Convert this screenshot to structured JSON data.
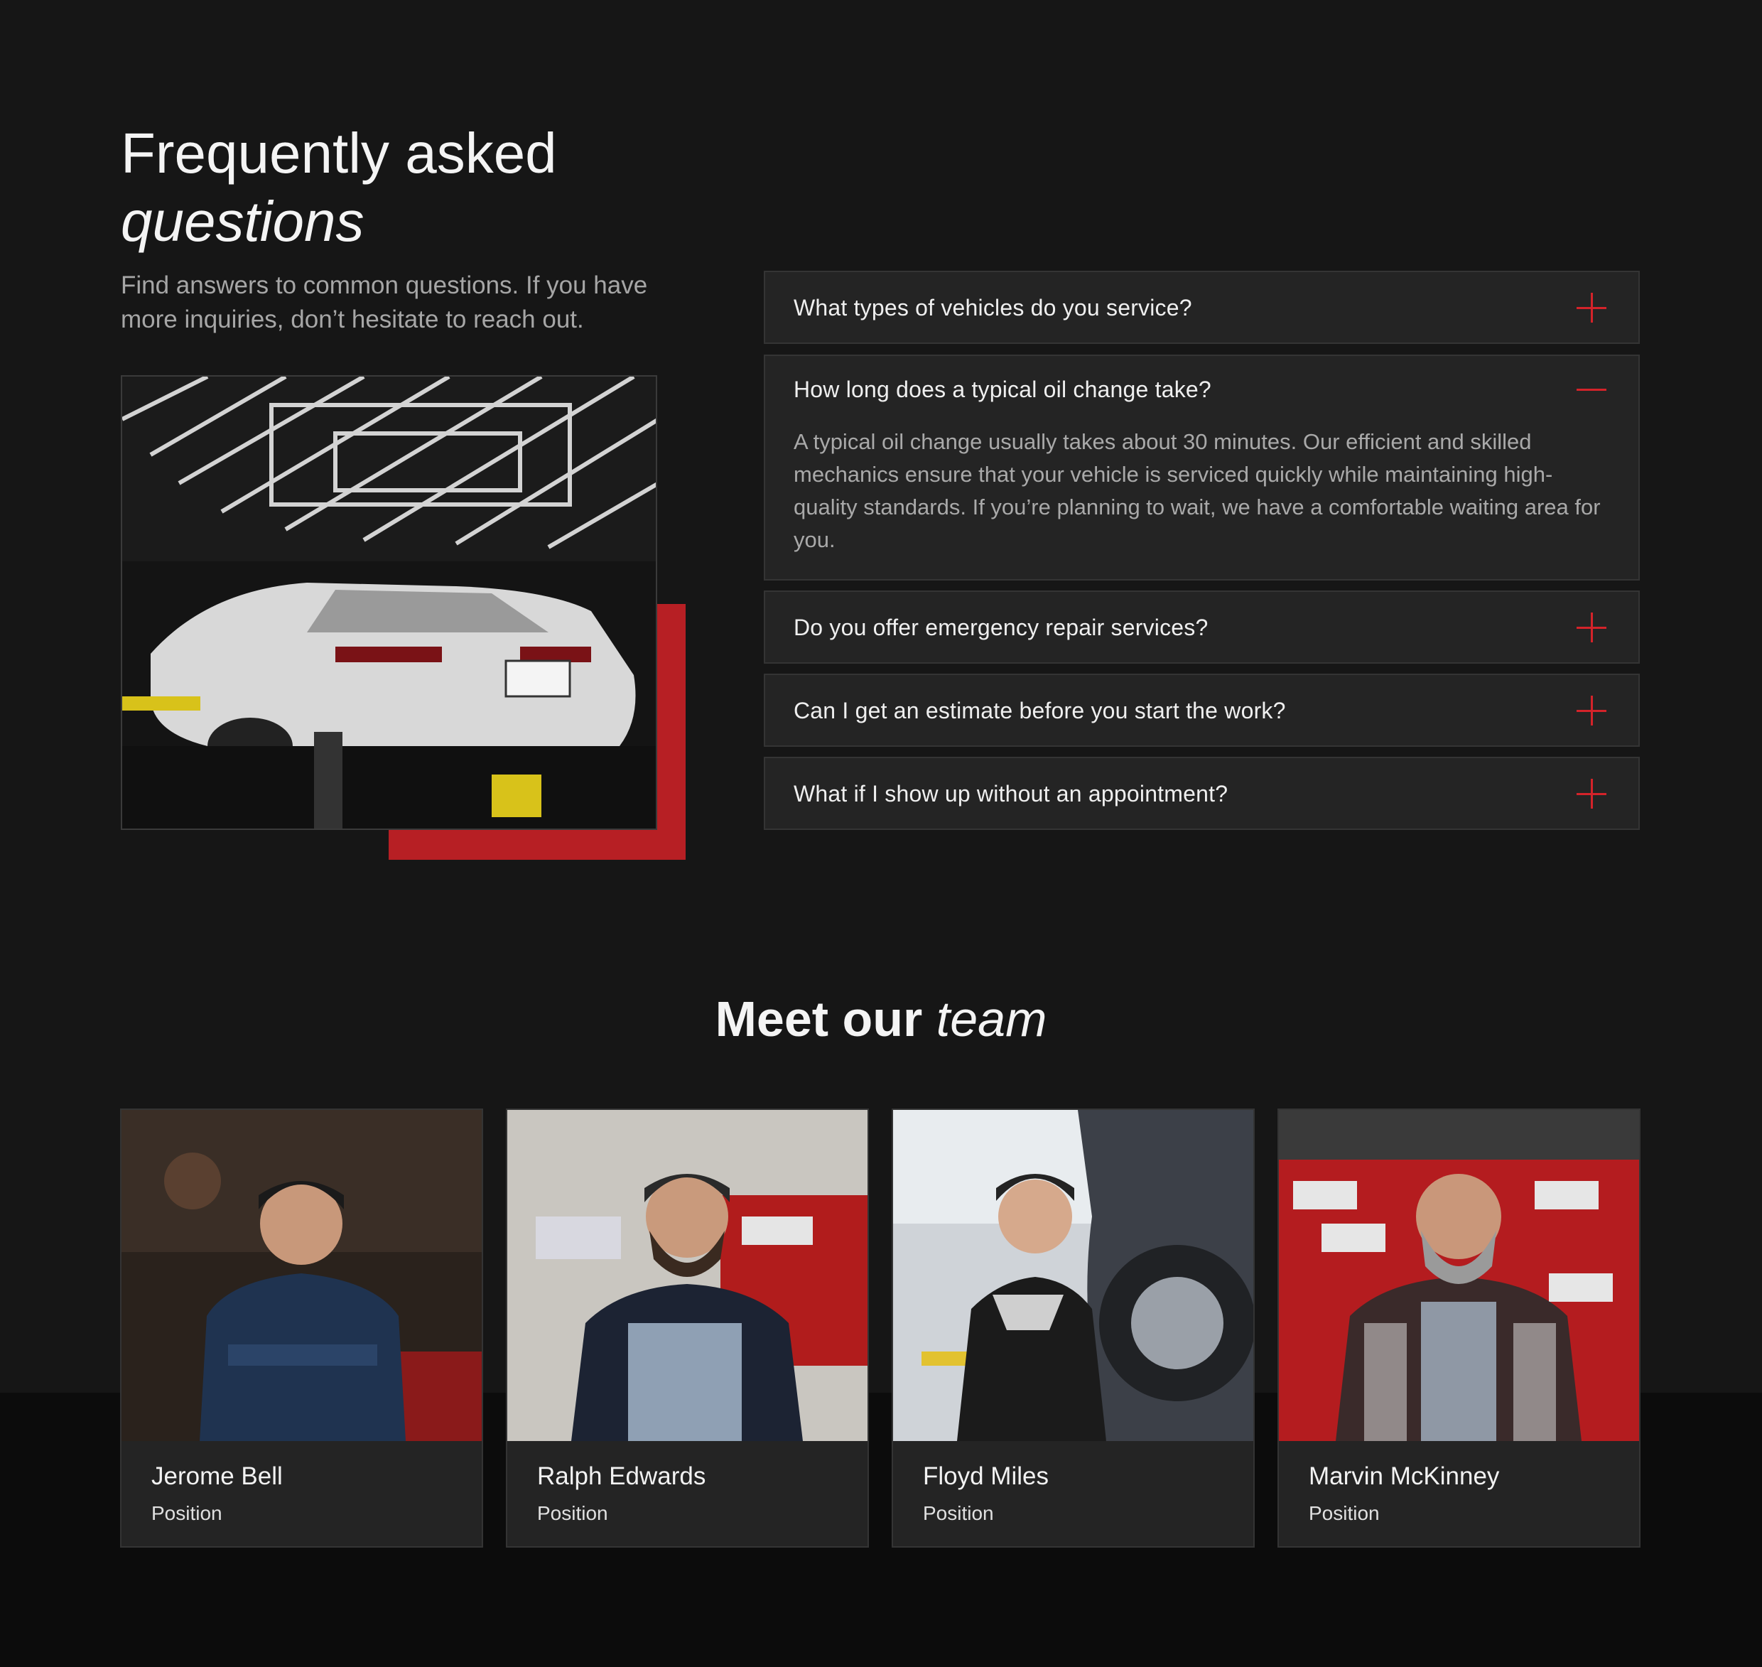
{
  "faq": {
    "title_line1": "Frequently asked",
    "title_line2": "questions",
    "subtitle": "Find answers to common questions. If you have more inquiries, don’t hesitate to reach out.",
    "items": [
      {
        "question": "What types of vehicles do you service?",
        "expanded": false
      },
      {
        "question": "How long does a typical oil change take?",
        "expanded": true,
        "answer": "A typical oil change usually takes about 30 minutes. Our efficient and skilled mechanics ensure that your vehicle is serviced quickly while maintaining high-quality standards. If you’re planning to wait, we have a comfortable waiting area for you."
      },
      {
        "question": "Do you offer emergency repair services?",
        "expanded": false
      },
      {
        "question": "Can I get an estimate before you start the work?",
        "expanded": false
      },
      {
        "question": "What if I show up without an appointment?",
        "expanded": false
      }
    ]
  },
  "team": {
    "title_bold": "Meet our",
    "title_italic": "team",
    "members": [
      {
        "name": "Jerome Bell",
        "position": "Position"
      },
      {
        "name": "Ralph Edwards",
        "position": "Position"
      },
      {
        "name": "Floyd Miles",
        "position": "Position"
      },
      {
        "name": "Marvin McKinney",
        "position": "Position"
      }
    ]
  },
  "colors": {
    "accent": "#d4232a",
    "accent_block": "#b71f24",
    "background": "#161616",
    "panel": "#242424"
  }
}
